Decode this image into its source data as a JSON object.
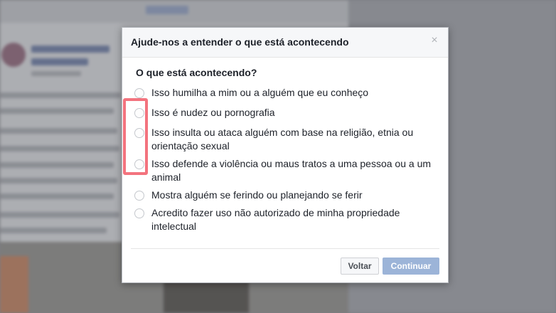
{
  "dialog": {
    "title": "Ajude-nos a entender o que está acontecendo",
    "close_glyph": "×",
    "question": "O que está acontecendo?",
    "options": [
      {
        "label": "Isso humilha a mim ou a alguém que eu conheço"
      },
      {
        "label": "Isso é nudez ou pornografia"
      },
      {
        "label": "Isso insulta ou ataca alguém com base na religião, etnia ou orientação sexual"
      },
      {
        "label": "Isso defende a violência ou maus tratos a uma pessoa ou a um animal"
      },
      {
        "label": "Mostra alguém se ferindo ou planejando se ferir"
      },
      {
        "label": "Acredito fazer uso não autorizado de minha propriedade intelectual"
      }
    ],
    "back_label": "Voltar",
    "continue_label": "Continuar"
  },
  "colors": {
    "continue_button": "#9cb4d8",
    "highlight": "#f26470",
    "header_bg": "#f6f7f9"
  },
  "icons": {
    "close": "close-icon",
    "radio": "radio-button"
  }
}
